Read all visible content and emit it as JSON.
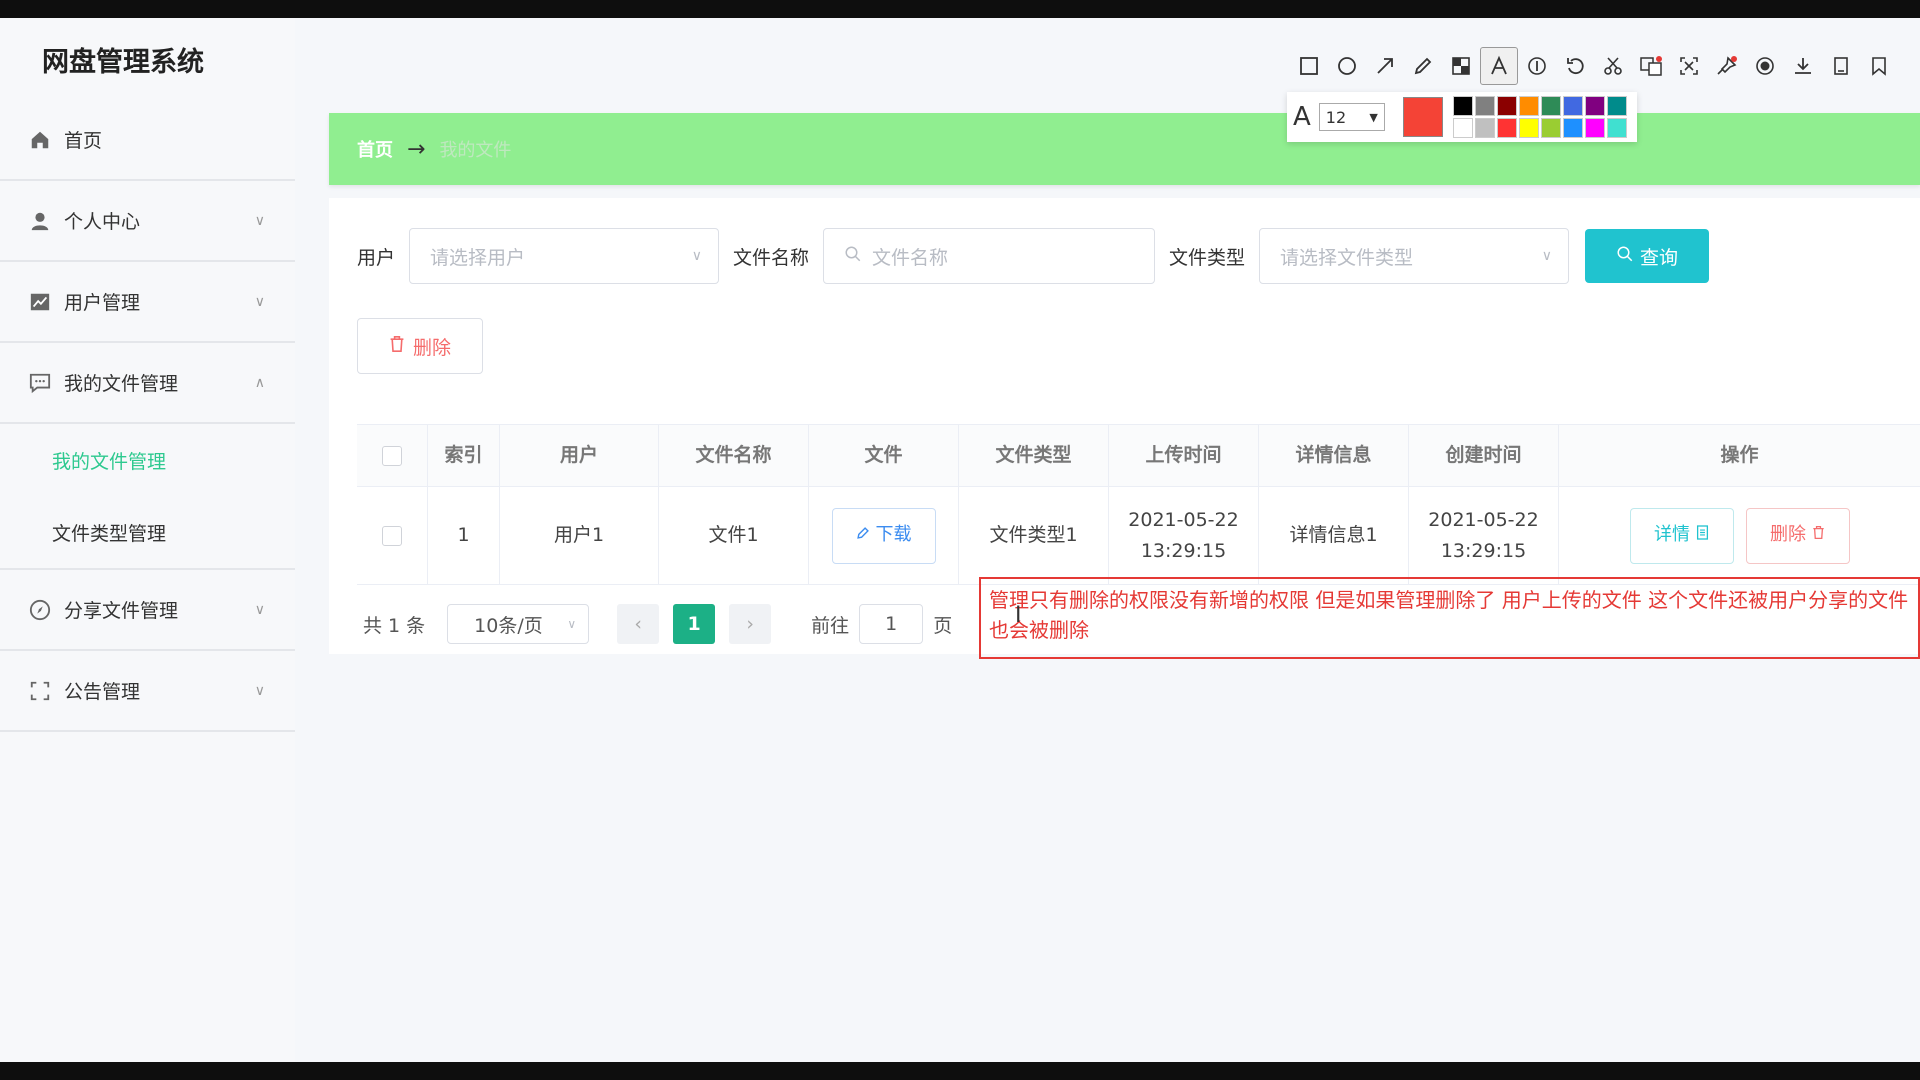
{
  "app": {
    "title": "网盘管理系统"
  },
  "sidebar": {
    "items": [
      {
        "label": "首页",
        "icon": "home-icon"
      },
      {
        "label": "个人中心",
        "icon": "user-icon"
      },
      {
        "label": "用户管理",
        "icon": "chart-icon"
      },
      {
        "label": "我的文件管理",
        "icon": "message-icon"
      },
      {
        "label": "分享文件管理",
        "icon": "compass-icon"
      },
      {
        "label": "公告管理",
        "icon": "fullscreen-icon"
      }
    ],
    "submenu": [
      {
        "label": "我的文件管理",
        "active": true
      },
      {
        "label": "文件类型管理",
        "active": false
      }
    ]
  },
  "breadcrumb": {
    "home": "首页",
    "separator": "→",
    "current": "我的文件"
  },
  "search": {
    "user_label": "用户",
    "user_placeholder": "请选择用户",
    "filename_label": "文件名称",
    "filename_placeholder": "文件名称",
    "filetype_label": "文件类型",
    "filetype_placeholder": "请选择文件类型",
    "query_label": "查询"
  },
  "toolbar": {
    "delete_label": "删除"
  },
  "table": {
    "headers": [
      "索引",
      "用户",
      "文件名称",
      "文件",
      "文件类型",
      "上传时间",
      "详情信息",
      "创建时间",
      "操作"
    ],
    "rows": [
      {
        "index": "1",
        "user": "用户1",
        "filename": "文件1",
        "download_label": "下载",
        "filetype": "文件类型1",
        "upload_date": "2021-05-22",
        "upload_time": "13:29:15",
        "detail_info": "详情信息1",
        "create_date": "2021-05-22",
        "create_time": "13:29:15",
        "detail_btn": "详情",
        "delete_btn": "删除"
      }
    ]
  },
  "pagination": {
    "total": "共 1 条",
    "page_size": "10条/页",
    "current_page": "1",
    "goto_label": "前往",
    "goto_value": "1",
    "goto_suffix": "页"
  },
  "annotation": {
    "text": "管理只有删除的权限没有新增的权限 但是如果管理删除了 用户上传的文件 这个文件还被用户分享的文件也会被删除",
    "color": "#e53935"
  },
  "capture_tool": {
    "font_size": "12",
    "current_color": "#f44336",
    "palette": [
      "#000000",
      "#808080",
      "#8b0000",
      "#ff8c00",
      "#2e8b57",
      "#4169e1",
      "#800080",
      "#008b8b",
      "#ffffff",
      "#c0c0c0",
      "#ff3333",
      "#ffff00",
      "#9acd32",
      "#1e90ff",
      "#ff00ff",
      "#40e0d0"
    ]
  },
  "colors": {
    "accent": "#2ec98f",
    "breadcrumb_bg": "#90ee90",
    "query_btn": "#20c3cf",
    "pager_active": "#1cb086"
  }
}
